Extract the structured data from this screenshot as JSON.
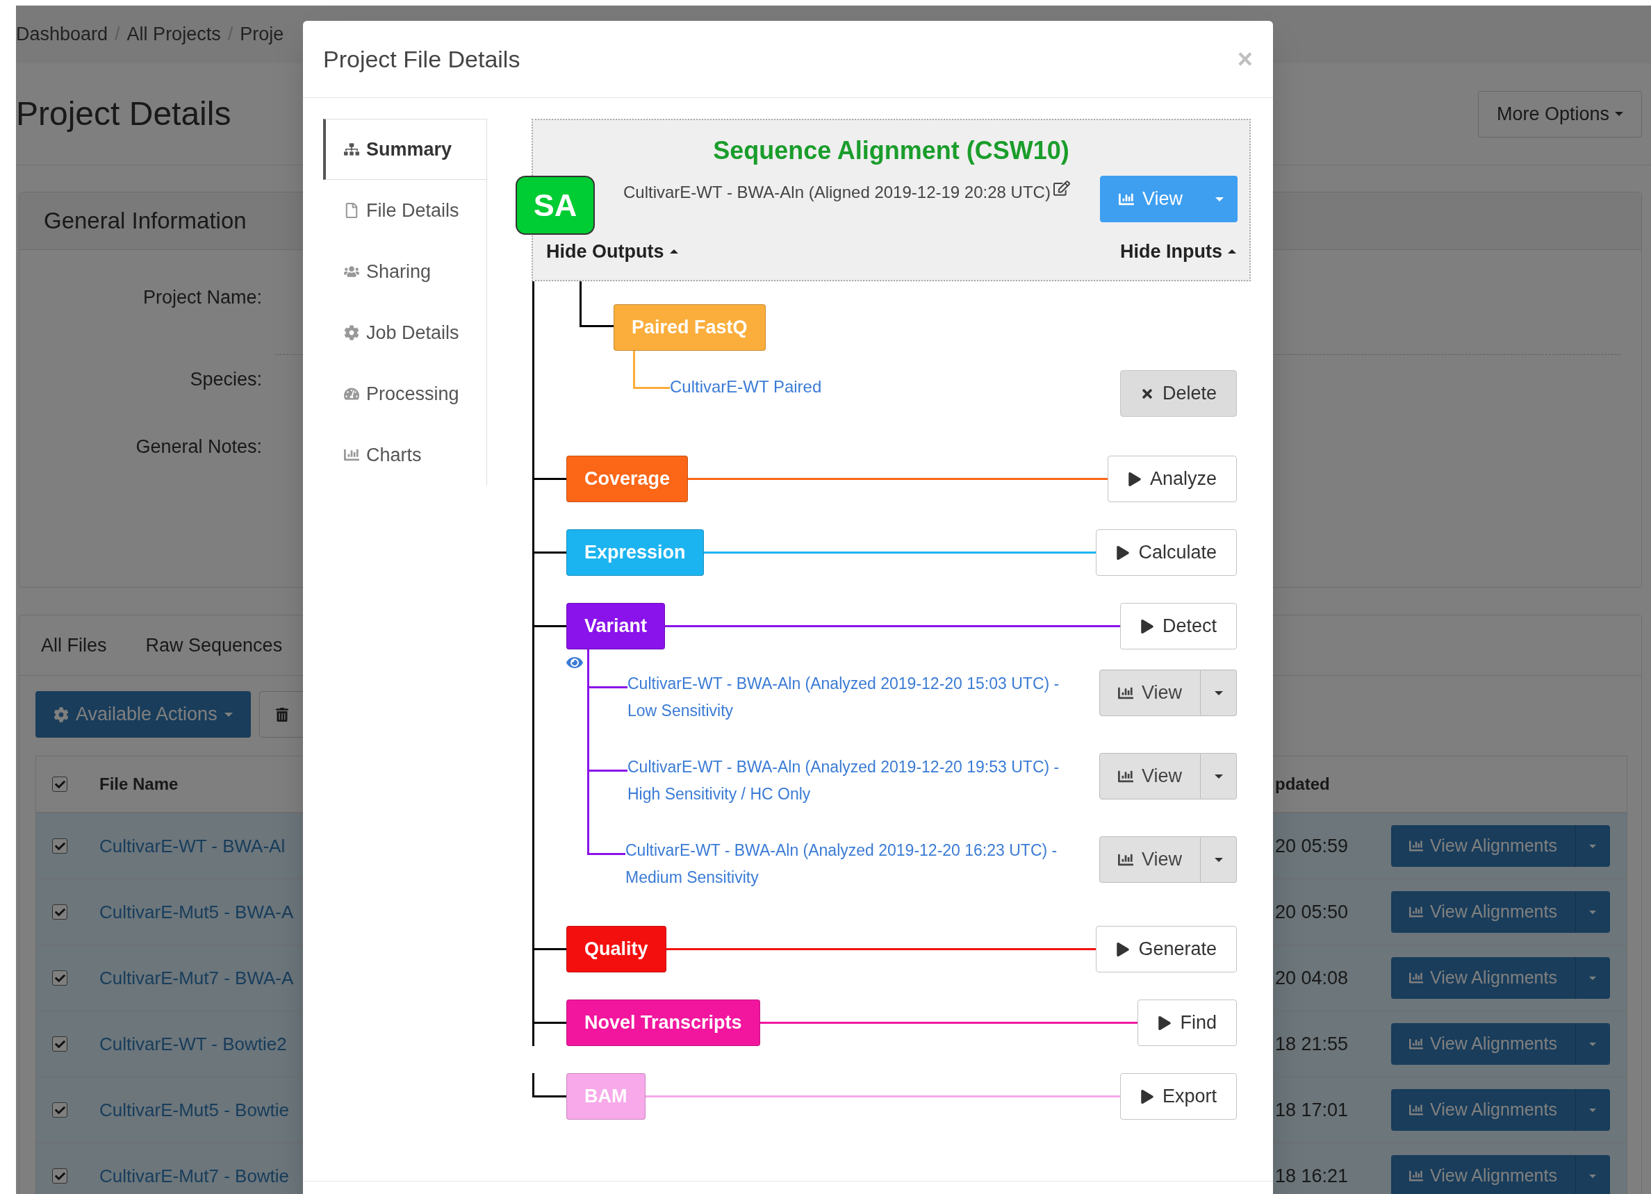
{
  "breadcrumb": {
    "separator": "/",
    "items": [
      "Dashboard",
      "All Projects",
      "Proje"
    ]
  },
  "page": {
    "title": "Project Details",
    "more_options": "More Options"
  },
  "general_information": {
    "title": "General Information",
    "fields": [
      "Project Name:",
      "Species:",
      "General Notes:"
    ]
  },
  "files": {
    "tabs": [
      "All Files",
      "Raw Sequences"
    ],
    "actions_button": "Available Actions",
    "table": {
      "select_all_checked": true,
      "columns": [
        "File Name",
        "pdated"
      ],
      "rows": [
        {
          "checked": true,
          "name": "CultivarE-WT - BWA-Al",
          "updated": "20 05:59",
          "action": "View Alignments"
        },
        {
          "checked": true,
          "name": "CultivarE-Mut5 - BWA-A",
          "updated": "20 05:50",
          "action": "View Alignments"
        },
        {
          "checked": true,
          "name": "CultivarE-Mut7 - BWA-A",
          "updated": "20 04:08",
          "action": "View Alignments"
        },
        {
          "checked": true,
          "name": "CultivarE-WT - Bowtie2",
          "updated": "18 21:55",
          "action": "View Alignments"
        },
        {
          "checked": true,
          "name": "CultivarE-Mut5 - Bowtie",
          "updated": "18 17:01",
          "action": "View Alignments"
        },
        {
          "checked": true,
          "name": "CultivarE-Mut7 - Bowtie",
          "updated": "18 16:21",
          "action": "View Alignments"
        }
      ]
    }
  },
  "modal": {
    "title": "Project File Details",
    "close": "×",
    "nav": [
      {
        "kind": "summary",
        "label": "Summary",
        "selected": true
      },
      {
        "kind": "file",
        "label": "File Details",
        "selected": false
      },
      {
        "kind": "sharing",
        "label": "Sharing",
        "selected": false
      },
      {
        "kind": "job",
        "label": "Job Details",
        "selected": false
      },
      {
        "kind": "processing",
        "label": "Processing",
        "selected": false
      },
      {
        "kind": "charts",
        "label": "Charts",
        "selected": false
      }
    ],
    "file": {
      "badge": "SA",
      "title": "Sequence Alignment (CSW10)",
      "subtitle": "CultivarE-WT - BWA-Aln (Aligned 2019-12-19 20:28 UTC)",
      "view_button": "View",
      "hide_outputs": "Hide Outputs",
      "hide_inputs": "Hide Inputs"
    },
    "inputs": [
      {
        "label": "Paired FastQ",
        "color": "#fbae3c",
        "file": "CultivarE-WT Paired",
        "action": "Delete"
      }
    ],
    "outputs": [
      {
        "label": "Coverage",
        "color": "#fb6617",
        "action": "Analyze"
      },
      {
        "label": "Expression",
        "color": "#1cb4f0",
        "action": "Calculate"
      },
      {
        "label": "Variant",
        "color": "#8a12ea",
        "action": "Detect",
        "results": [
          {
            "name": "CultivarE-WT - BWA-Aln (Analyzed 2019-12-20 15:03 UTC) - Low Sensitivity",
            "button": "View"
          },
          {
            "name": "CultivarE-WT - BWA-Aln (Analyzed 2019-12-20 19:53 UTC) - High Sensitivity / HC Only",
            "button": "View"
          },
          {
            "name": "CultivarE-WT - BWA-Aln (Analyzed 2019-12-20 16:23 UTC) - Medium Sensitivity",
            "button": "View"
          }
        ]
      },
      {
        "label": "Quality",
        "color": "#f40f0f",
        "action": "Generate"
      },
      {
        "label": "Novel Transcripts",
        "color": "#f2169f",
        "action": "Find"
      },
      {
        "label": "BAM",
        "color": "#f7a9ea",
        "action": "Export"
      }
    ]
  }
}
